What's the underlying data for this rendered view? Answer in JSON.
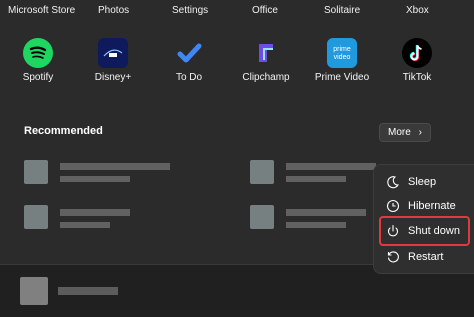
{
  "pinned_top": [
    "Microsoft Store",
    "Photos",
    "Settings",
    "Office",
    "Solitaire",
    "Xbox"
  ],
  "pinned_apps": [
    {
      "label": "Spotify",
      "icon": "spotify-icon",
      "color": "#1ed760"
    },
    {
      "label": "Disney+",
      "icon": "disney-plus-icon",
      "color": "#0e1a5c"
    },
    {
      "label": "To Do",
      "icon": "todo-icon",
      "color": "#3f87f5"
    },
    {
      "label": "Clipchamp",
      "icon": "clipchamp-icon",
      "color": "#6c4de6"
    },
    {
      "label": "Prime Video",
      "icon": "prime-video-icon",
      "color": "#1f9adf"
    },
    {
      "label": "TikTok",
      "icon": "tiktok-icon",
      "color": "#000000"
    }
  ],
  "recommended": {
    "title": "Recommended",
    "more_label": "More"
  },
  "power_menu": {
    "items": [
      {
        "label": "Sleep",
        "icon": "moon-icon"
      },
      {
        "label": "Hibernate",
        "icon": "clock-icon"
      },
      {
        "label": "Shut down",
        "icon": "power-icon"
      },
      {
        "label": "Restart",
        "icon": "restart-icon"
      }
    ],
    "highlight_color": "#e0393e"
  },
  "icons": {
    "prime_text_1": "prime",
    "prime_text_2": "video"
  }
}
